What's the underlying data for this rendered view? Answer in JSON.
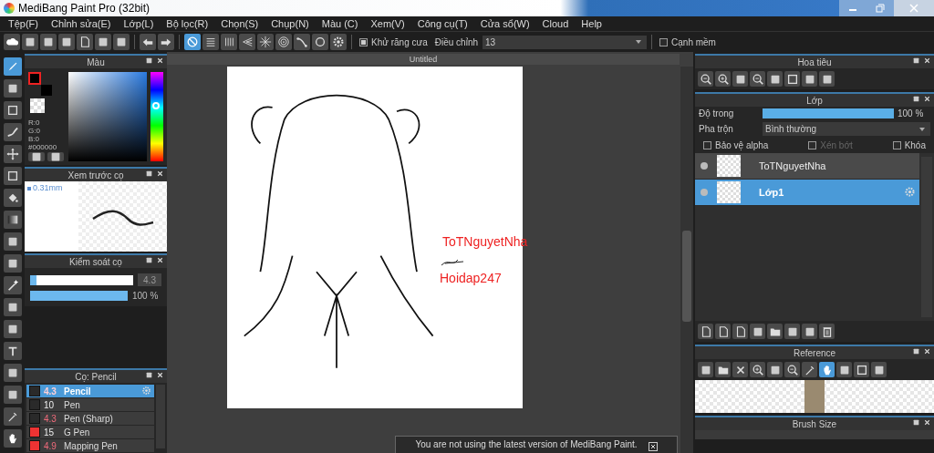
{
  "window": {
    "title": "MediBang Paint Pro (32bit)"
  },
  "menu": [
    "Tệp(F)",
    "Chỉnh sửa(E)",
    "Lớp(L)",
    "Bộ lọc(R)",
    "Chọn(S)",
    "Chụp(N)",
    "Màu (C)",
    "Xem(V)",
    "Công cụ(T)",
    "Cửa sổ(W)",
    "Cloud",
    "Help"
  ],
  "toolbar": {
    "snap_tools": [
      {
        "selected": true
      },
      {
        "selected": false
      },
      {
        "selected": false
      },
      {
        "selected": false
      },
      {
        "selected": false
      },
      {
        "selected": false
      },
      {
        "selected": false
      },
      {
        "selected": false
      },
      {
        "selected": false
      }
    ],
    "antialias": {
      "label": "Khử răng cưa",
      "checked": true
    },
    "adjust": {
      "label": "Điều chỉnh",
      "value": "13"
    },
    "smooth": {
      "label": "Cạnh mềm",
      "checked": false
    }
  },
  "tools": [
    {
      "selected": true
    },
    {
      "selected": false
    },
    {
      "selected": false
    },
    {
      "selected": false
    },
    {
      "selected": false
    },
    {
      "selected": false
    },
    {
      "selected": false
    },
    {
      "selected": false
    },
    {
      "selected": false
    },
    {
      "selected": false
    },
    {
      "selected": false
    },
    {
      "selected": false
    },
    {
      "selected": false
    },
    {
      "selected": false
    },
    {
      "selected": false
    },
    {
      "selected": false
    },
    {
      "selected": false
    },
    {
      "selected": false
    }
  ],
  "color_panel": {
    "title": "Màu",
    "values": [
      "R:0",
      "G:0",
      "B:0"
    ],
    "hex": "#000000",
    "hue": {
      "level": 0.62
    }
  },
  "brush_preview": {
    "title": "Xem trước cọ",
    "size": "0.31mm"
  },
  "brush_control": {
    "title": "Kiểm soát cọ",
    "size": {
      "level": 0.06,
      "value": "4.3"
    },
    "opacity": {
      "level": 1,
      "reading": "100 %"
    }
  },
  "brush_list": {
    "title": "Cọ: Pencil",
    "items": [
      {
        "size": "4.3",
        "name": "Pencil",
        "color": "#2a2a2a",
        "pressure": true,
        "selected": true
      },
      {
        "size": "10",
        "name": "Pen",
        "color": "#2a2a2a",
        "pressure": false,
        "selected": false
      },
      {
        "size": "4.3",
        "name": "Pen (Sharp)",
        "color": "#2a2a2a",
        "pressure": true,
        "selected": false
      },
      {
        "size": "15",
        "name": "G Pen",
        "color": "#ee3333",
        "pressure": false,
        "selected": false
      },
      {
        "size": "4.9",
        "name": "Mapping Pen",
        "color": "#ee3333",
        "pressure": true,
        "selected": false
      }
    ]
  },
  "canvas": {
    "tab": "Untitled",
    "texts": [
      "ToTNguyetNha",
      "Hoidap247"
    ]
  },
  "notification": {
    "text": "You are not using the latest version of MediBang Paint."
  },
  "navigator": {
    "title": "Hoa tiêu"
  },
  "layers": {
    "title": "Lớp",
    "opacity": {
      "label": "Độ trong",
      "level": 1,
      "reading": "100 %"
    },
    "blend_label": "Pha trộn",
    "blend_value": "Bình thường",
    "options": [
      {
        "label": "Bảo vệ alpha",
        "checked": false,
        "disabled": false
      },
      {
        "label": "Xén bớt",
        "checked": false,
        "disabled": true
      },
      {
        "label": "Khóa",
        "checked": false,
        "disabled": false
      }
    ],
    "items": [
      {
        "name": "ToTNguyetNha",
        "selected": false
      },
      {
        "name": "Lớp1",
        "selected": true
      }
    ]
  },
  "reference": {
    "title": "Reference",
    "tools": [
      {
        "selected": false
      },
      {
        "selected": false
      },
      {
        "selected": false
      },
      {
        "selected": false
      },
      {
        "selected": false
      },
      {
        "selected": false
      },
      {
        "selected": false
      },
      {
        "selected": true
      },
      {
        "selected": false
      },
      {
        "selected": false
      },
      {
        "selected": false
      }
    ]
  },
  "brush_size": {
    "title": "Brush Size"
  }
}
